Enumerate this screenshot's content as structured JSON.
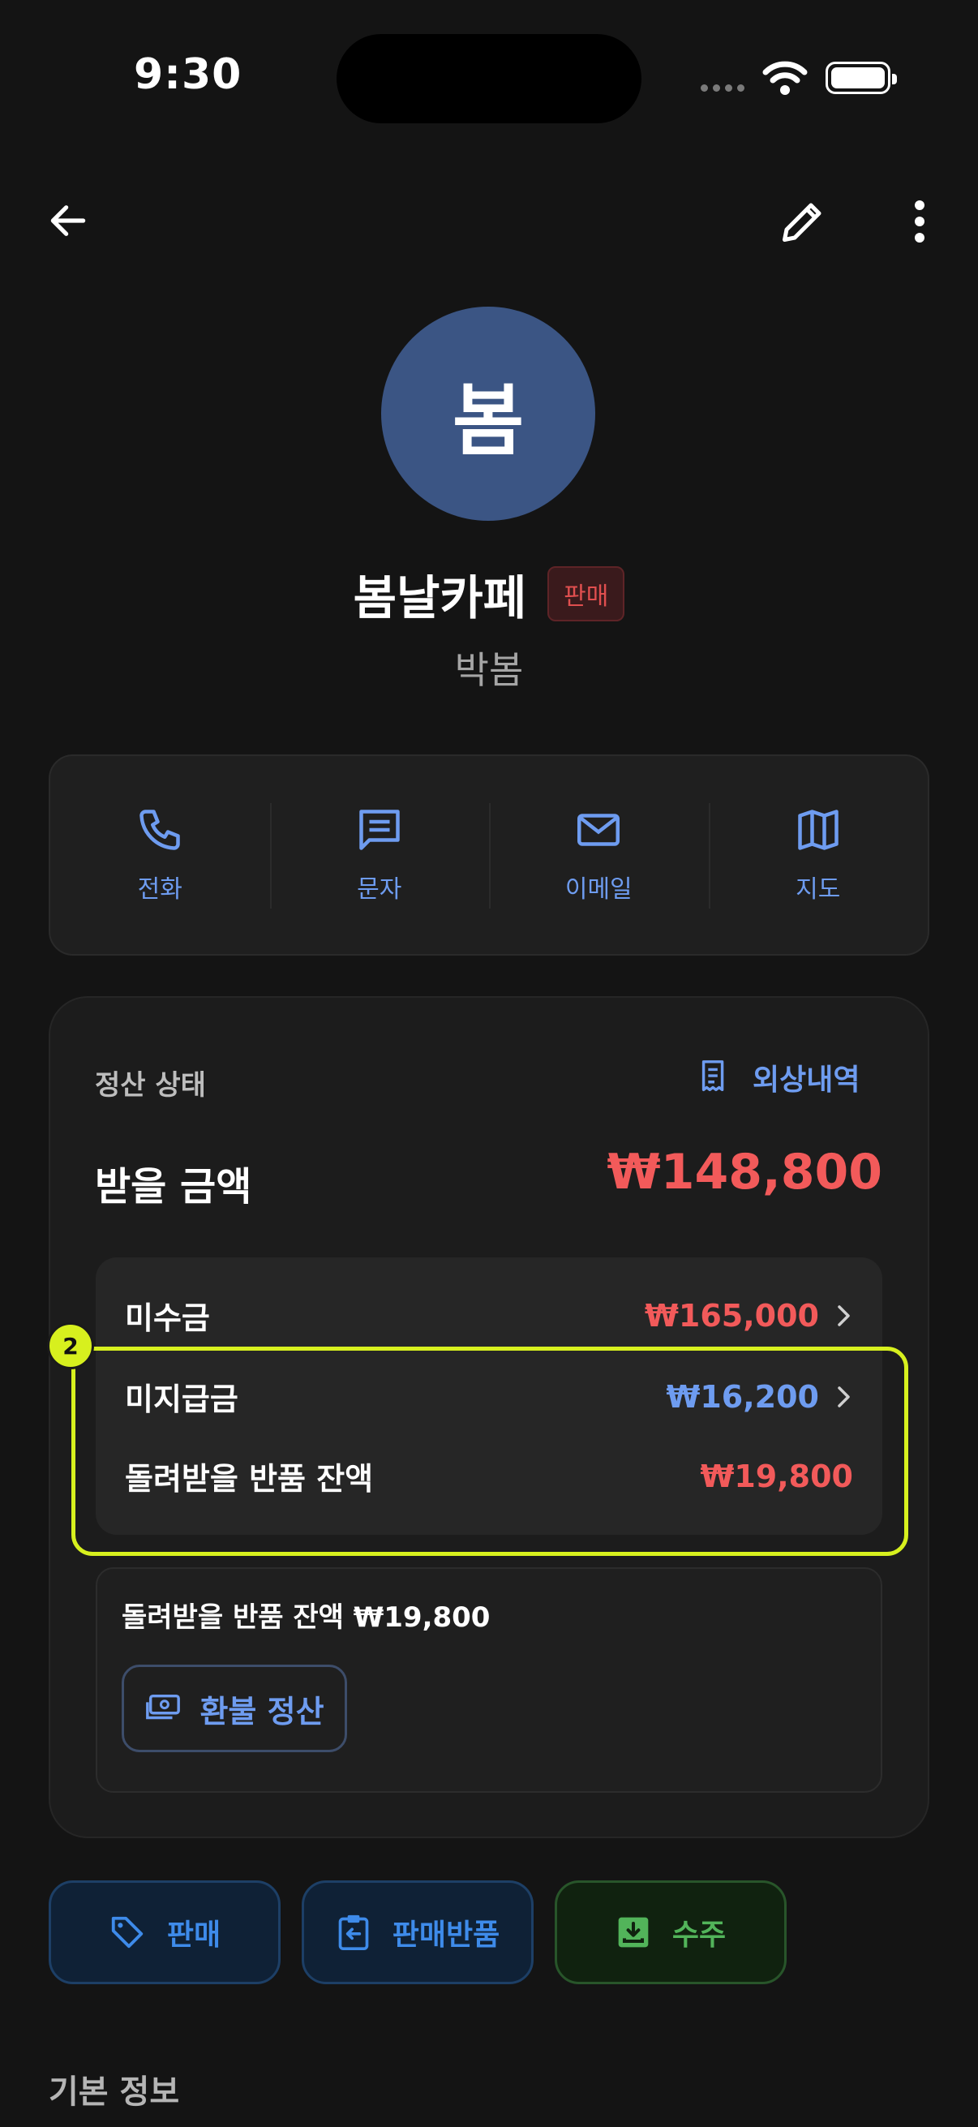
{
  "status_bar": {
    "time": "9:30"
  },
  "profile": {
    "avatar_text": "봄",
    "name": "봄날카페",
    "type_badge": "판매",
    "contact_person": "박봄"
  },
  "contact_actions": [
    {
      "label": "전화",
      "icon": "phone-icon"
    },
    {
      "label": "문자",
      "icon": "message-icon"
    },
    {
      "label": "이메일",
      "icon": "mail-icon"
    },
    {
      "label": "지도",
      "icon": "map-icon"
    }
  ],
  "settlement": {
    "title": "정산 상태",
    "history_label": "외상내역",
    "receivable_label": "받을 금액",
    "receivable_amount": "₩148,800",
    "rows": [
      {
        "label": "미수금",
        "amount": "₩165,000"
      },
      {
        "label": "미지급금",
        "amount": "₩16,200"
      },
      {
        "label": "돌려받을 반품 잔액",
        "amount": "₩19,800"
      }
    ],
    "highlight_index": "2",
    "refund_text": "돌려받을 반품 잔액 ₩19,800",
    "refund_button": "환불 정산"
  },
  "actions": [
    {
      "label": "판매",
      "icon": "tag-icon"
    },
    {
      "label": "판매반품",
      "icon": "return-icon"
    },
    {
      "label": "수주",
      "icon": "inbox-download-icon"
    }
  ],
  "sections": {
    "basic_info": "기본 정보"
  },
  "colors": {
    "accent_blue": "#6e9cf0",
    "negative_red": "#f25a5a",
    "highlight": "#d7f01e",
    "avatar": "#3b5584"
  }
}
